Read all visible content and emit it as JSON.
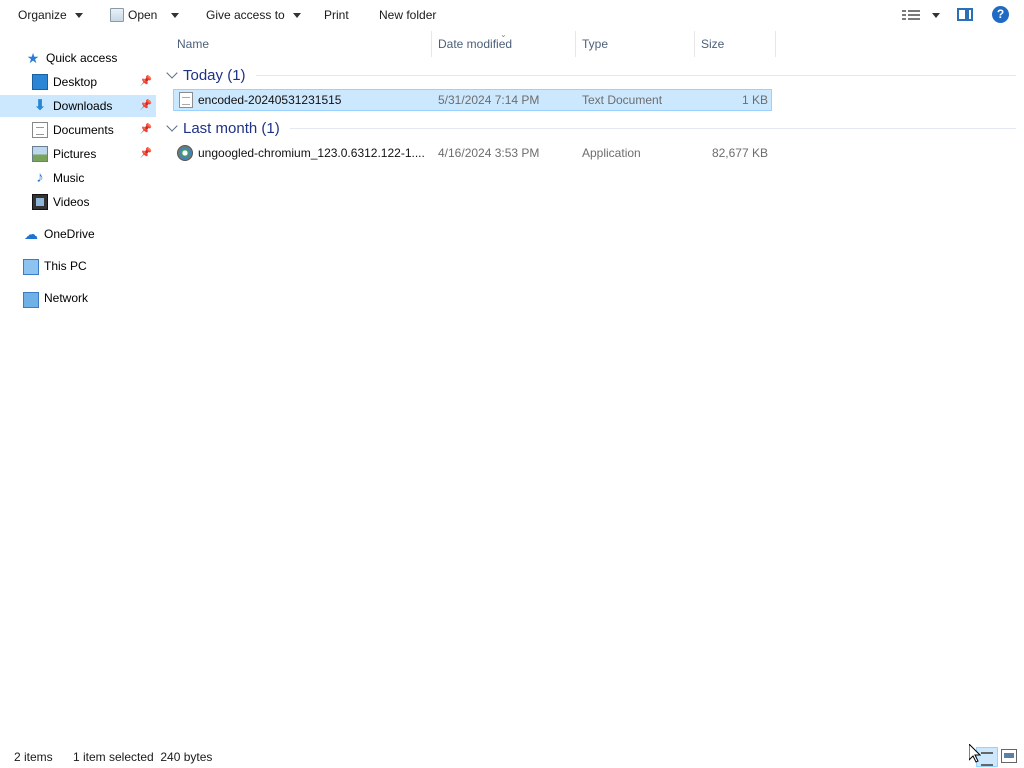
{
  "toolbar": {
    "organize": "Organize",
    "open": "Open",
    "give_access": "Give access to",
    "print": "Print",
    "new_folder": "New folder"
  },
  "nav": {
    "quick_access": "Quick access",
    "items": [
      {
        "label": "Desktop",
        "icon": "desktop-icon",
        "pinned": true
      },
      {
        "label": "Downloads",
        "icon": "download-icon",
        "pinned": true,
        "selected": true
      },
      {
        "label": "Documents",
        "icon": "documents-icon",
        "pinned": true
      },
      {
        "label": "Pictures",
        "icon": "pictures-icon",
        "pinned": true
      },
      {
        "label": "Music",
        "icon": "music-icon",
        "pinned": false
      },
      {
        "label": "Videos",
        "icon": "videos-icon",
        "pinned": false
      }
    ],
    "onedrive": "OneDrive",
    "this_pc": "This PC",
    "network": "Network"
  },
  "columns": {
    "name": "Name",
    "date_modified": "Date modified",
    "type": "Type",
    "size": "Size"
  },
  "groups": [
    {
      "header": "Today (1)",
      "files": [
        {
          "name": "encoded-20240531231515",
          "date": "5/31/2024 7:14 PM",
          "type": "Text Document",
          "size": "1 KB",
          "icon": "text-file-icon",
          "selected": true
        }
      ]
    },
    {
      "header": "Last month (1)",
      "files": [
        {
          "name": "ungoogled-chromium_123.0.6312.122-1....",
          "date": "4/16/2024 3:53 PM",
          "type": "Application",
          "size": "82,677 KB",
          "icon": "application-icon",
          "selected": false
        }
      ]
    }
  ],
  "status": {
    "item_count": "2 items",
    "selection": "1 item selected  240 bytes"
  },
  "colors": {
    "selection_bg": "#cce8ff",
    "selection_border": "#99d1ff",
    "group_header": "#1e3287",
    "column_header": "#4c607a",
    "accent": "#1f6ac3"
  }
}
